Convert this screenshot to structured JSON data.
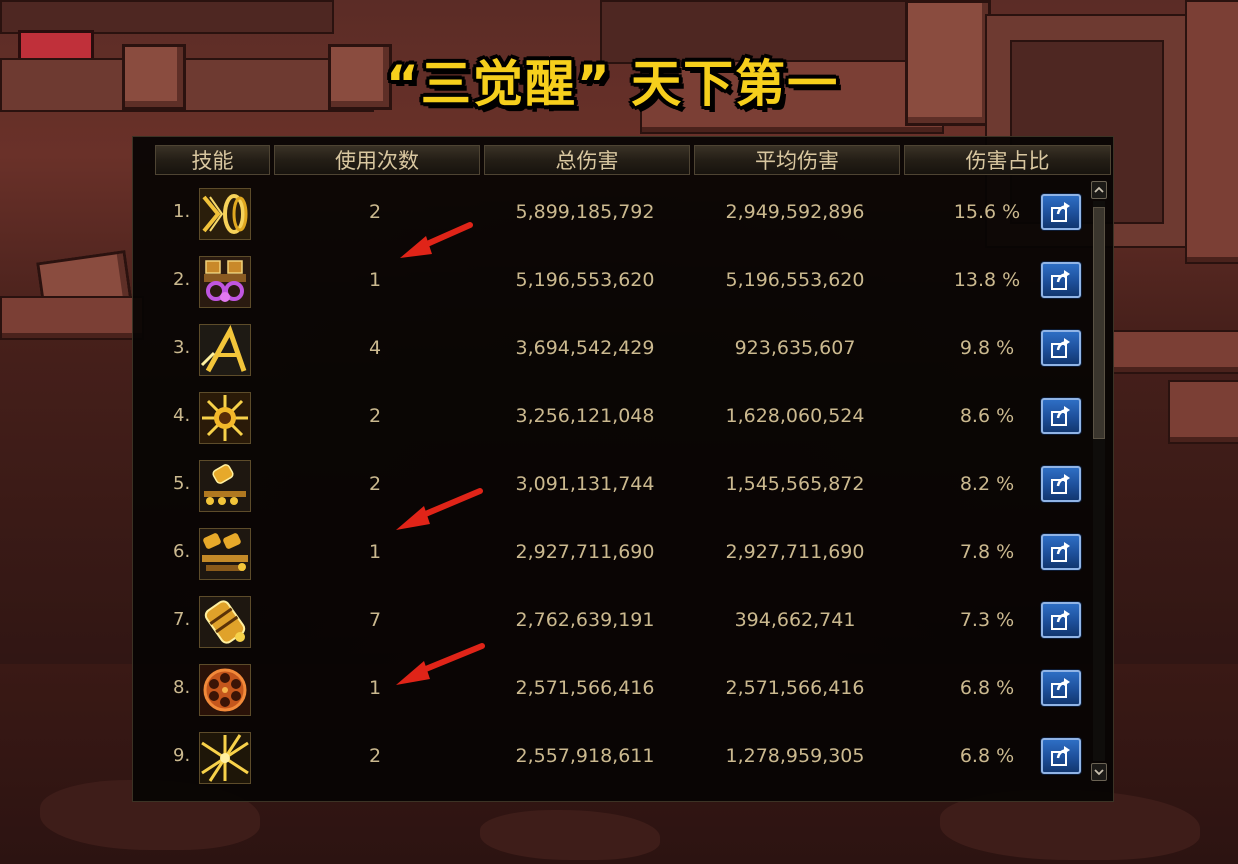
{
  "title": "“三觉醒” 天下第一",
  "table": {
    "headers": [
      "技能",
      "使用次数",
      "总伤害",
      "平均伤害",
      "伤害占比"
    ],
    "rows": [
      {
        "rank": "1.",
        "uses": "2",
        "total": "5,899,185,792",
        "avg": "2,949,592,896",
        "pct": "15.6 %",
        "icon": "twin-rings-skill-icon"
      },
      {
        "rank": "2.",
        "uses": "1",
        "total": "5,196,553,620",
        "avg": "5,196,553,620",
        "pct": "13.8 %",
        "icon": "purple-chains-skill-icon"
      },
      {
        "rank": "3.",
        "uses": "4",
        "total": "3,694,542,429",
        "avg": "923,635,607",
        "pct": "9.8 %",
        "icon": "tripod-strike-skill-icon"
      },
      {
        "rank": "4.",
        "uses": "2",
        "total": "3,256,121,048",
        "avg": "1,628,060,524",
        "pct": "8.6 %",
        "icon": "burst-explosion-skill-icon"
      },
      {
        "rank": "5.",
        "uses": "2",
        "total": "3,091,131,744",
        "avg": "1,545,565,872",
        "pct": "8.2 %",
        "icon": "bullet-barrage-skill-icon"
      },
      {
        "rank": "6.",
        "uses": "1",
        "total": "2,927,711,690",
        "avg": "2,927,711,690",
        "pct": "7.8 %",
        "icon": "twin-bullets-skill-icon"
      },
      {
        "rank": "7.",
        "uses": "7",
        "total": "2,762,639,191",
        "avg": "394,662,741",
        "pct": "7.3 %",
        "icon": "grenade-bundle-skill-icon"
      },
      {
        "rank": "8.",
        "uses": "1",
        "total": "2,571,566,416",
        "avg": "2,571,566,416",
        "pct": "6.8 %",
        "icon": "revolver-cylinder-skill-icon"
      },
      {
        "rank": "9.",
        "uses": "2",
        "total": "2,557,918,611",
        "avg": "1,278,959,305",
        "pct": "6.8 %",
        "icon": "radial-blast-skill-icon"
      }
    ]
  },
  "colors": {
    "title": "#f6cf1c",
    "text": "#cbb98f",
    "header_text": "#d9c7a0",
    "share_button": "#1d4f9a",
    "annotation_arrow": "#e02418"
  }
}
